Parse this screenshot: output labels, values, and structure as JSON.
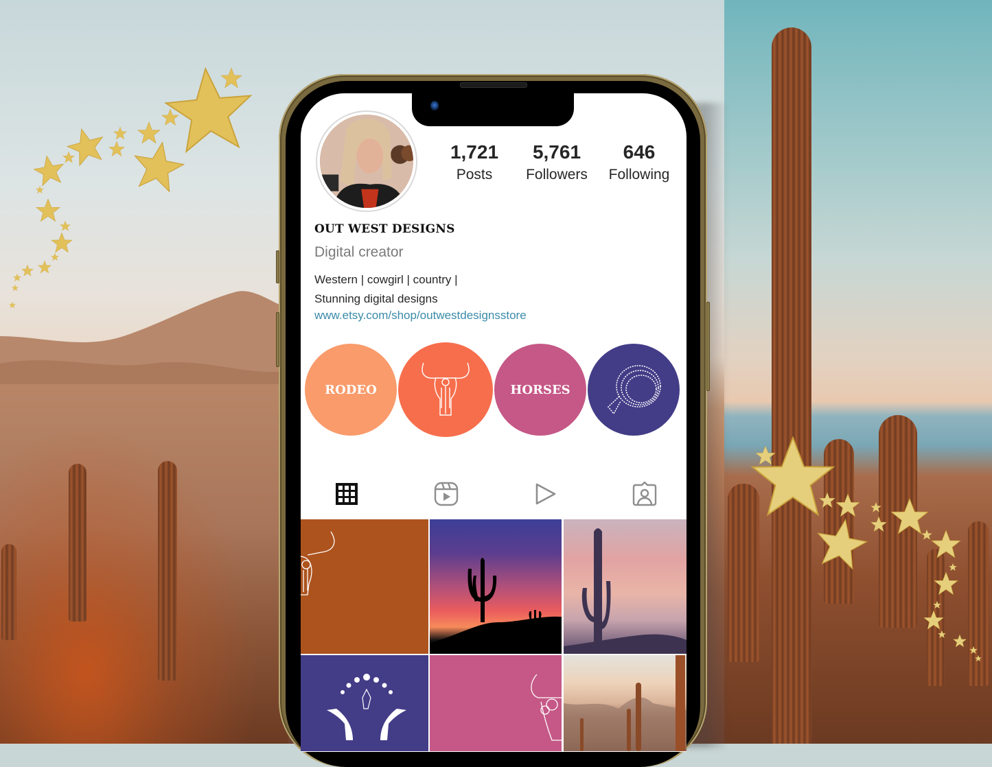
{
  "profile": {
    "stats": [
      {
        "value": "1,721",
        "label": "Posts"
      },
      {
        "value": "5,761",
        "label": "Followers"
      },
      {
        "value": "646",
        "label": "Following"
      }
    ],
    "username": "OUT WEST DESIGNS",
    "category": "Digital creator",
    "bio_lines": [
      "Western | cowgirl | country |",
      "Stunning digital designs"
    ],
    "link": "www.etsy.com/shop/outwestdesignsstore"
  },
  "highlights": [
    {
      "label": "RODEO",
      "icon": "",
      "color": "#f99b6b"
    },
    {
      "label": "",
      "icon": "bull-skull-icon",
      "color": "#f76e4c"
    },
    {
      "label": "HORSES",
      "icon": "",
      "color": "#c55886"
    },
    {
      "label": "",
      "icon": "lasso-icon",
      "color": "#433c87"
    }
  ],
  "tabs": [
    {
      "name": "posts-grid",
      "icon": "grid-icon",
      "active": true
    },
    {
      "name": "reels",
      "icon": "reels-icon",
      "active": false
    },
    {
      "name": "videos",
      "icon": "play-icon",
      "active": false
    },
    {
      "name": "tagged",
      "icon": "tagged-user-icon",
      "active": false
    }
  ],
  "posts": [
    {
      "desc": "bull skull on rust background",
      "color": "#ad531e"
    },
    {
      "desc": "saguaro silhouette at purple-pink sunset",
      "color": "#4a3d8f"
    },
    {
      "desc": "saguaro silhouette against pink clouds",
      "color": "#c9a4a7"
    },
    {
      "desc": "moon phases with hands holding crystal",
      "color": "#433c87"
    },
    {
      "desc": "floral bull skull on pink background",
      "color": "#c55886"
    },
    {
      "desc": "desert cactus landscape at dusk",
      "color": "#d8b39a"
    }
  ],
  "colors": {
    "frame_gold": "#7a6a3f",
    "link_blue": "#3a8ba8",
    "text_dark": "#262626",
    "text_gray": "#7a7a7a"
  }
}
